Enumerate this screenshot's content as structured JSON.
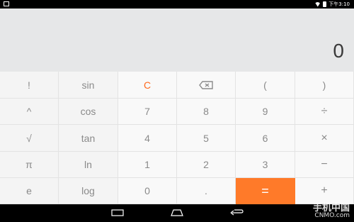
{
  "status_bar": {
    "time": "下午3:10"
  },
  "display": {
    "result": "0"
  },
  "keys": {
    "r1": [
      "!",
      "sin",
      "C",
      "backspace",
      "(",
      ")"
    ],
    "r2": [
      "^",
      "cos",
      "7",
      "8",
      "9",
      "÷"
    ],
    "r3": [
      "√",
      "tan",
      "4",
      "5",
      "6",
      "×"
    ],
    "r4": [
      "π",
      "ln",
      "1",
      "2",
      "3",
      "−"
    ],
    "r5": [
      "e",
      "log",
      "0",
      ".",
      "=",
      "+"
    ]
  },
  "colors": {
    "accent": "#ff6a1f",
    "equals_bg": "#ff7a29",
    "display_bg": "#e6e7e8"
  },
  "watermark": {
    "line1": "手机中国",
    "line2": "CNMO.com"
  }
}
